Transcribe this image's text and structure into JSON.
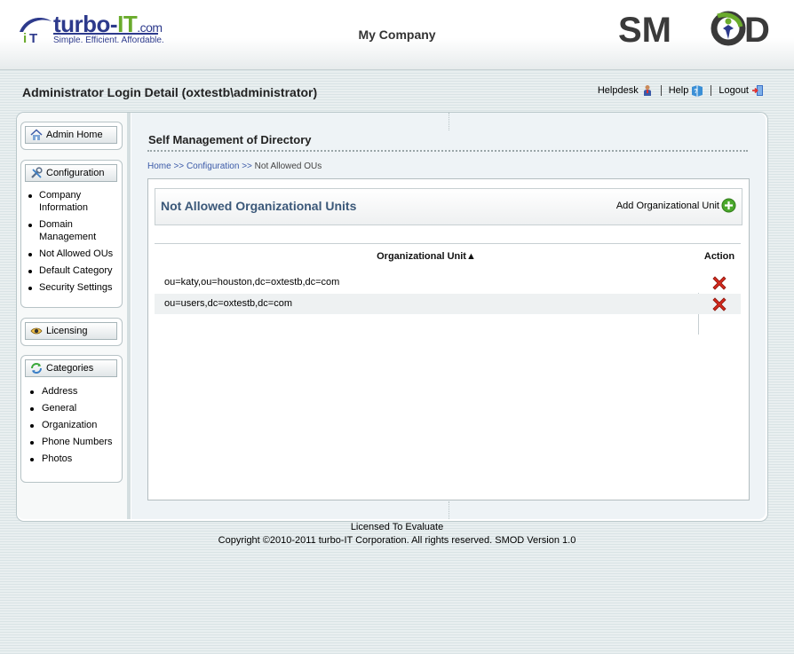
{
  "header": {
    "logo_left": {
      "word": "turbo",
      "dash": "-",
      "it": "IT",
      "com": ".com",
      "tagline": "Simple.  Efficient.  Affordable."
    },
    "company_name": "My Company",
    "logo_right": {
      "text_before": "SM",
      "text_after": "D"
    }
  },
  "login_detail": "Administrator Login Detail (oxtestb\\administrator)",
  "toplinks": {
    "helpdesk": "Helpdesk",
    "help": "Help",
    "logout": "Logout"
  },
  "sidebar": {
    "admin_home": "Admin Home",
    "configuration": {
      "label": "Configuration",
      "items": [
        "Company Information",
        "Domain Management",
        "Not Allowed OUs",
        "Default Category",
        "Security Settings"
      ]
    },
    "licensing": "Licensing",
    "categories": {
      "label": "Categories",
      "items": [
        "Address",
        "General",
        "Organization",
        "Phone Numbers",
        "Photos"
      ]
    }
  },
  "main": {
    "page_title": "Self Management of Directory",
    "breadcrumb": {
      "home": "Home",
      "sep1": " >> ",
      "configuration": "Configuration",
      "sep2": " >> ",
      "current": "Not Allowed OUs"
    },
    "panel_title": "Not Allowed Organizational Units",
    "add_label": "Add Organizational Unit",
    "table": {
      "col_ou": "Organizational Unit",
      "sort_glyph": "▲",
      "col_action": "Action",
      "rows": [
        {
          "ou": "ou=katy,ou=houston,dc=oxtestb,dc=com"
        },
        {
          "ou": "ou=users,dc=oxtestb,dc=com"
        }
      ]
    }
  },
  "footer": {
    "license": "Licensed To Evaluate",
    "copyright": "Copyright ©2010-2011 turbo-IT Corporation. All rights reserved. SMOD Version 1.0"
  },
  "colors": {
    "brand_blue": "#2d3a8c",
    "brand_green": "#6aab2c",
    "link_blue": "#3b5aa8",
    "panel_title": "#3b5879",
    "delete_red": "#d42a1e",
    "add_green": "#4aa82c"
  }
}
